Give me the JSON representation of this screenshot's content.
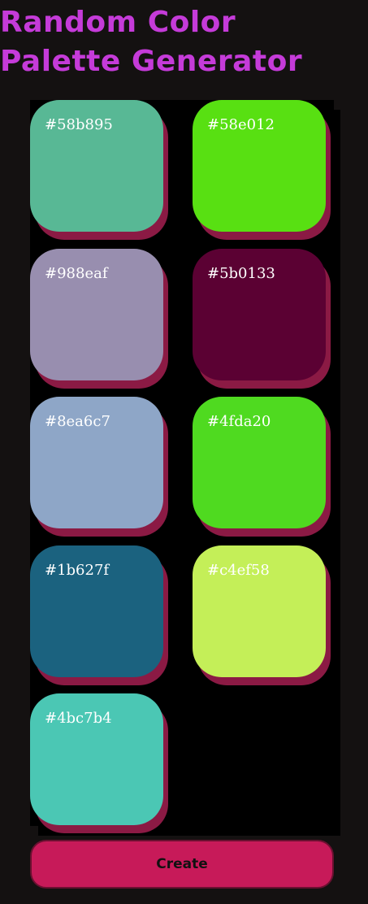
{
  "title": {
    "line1": "Random Color",
    "line2": "Palette Generator"
  },
  "palette": {
    "swatches": [
      {
        "hex": "#58b895",
        "color": "#58b895"
      },
      {
        "hex": "#58e012",
        "color": "#58e012"
      },
      {
        "hex": "#988eaf",
        "color": "#988eaf"
      },
      {
        "hex": "#5b0133",
        "color": "#5b0133"
      },
      {
        "hex": "#8ea6c7",
        "color": "#8ea6c7"
      },
      {
        "hex": "#4fda20",
        "color": "#4fda20"
      },
      {
        "hex": "#1b627f",
        "color": "#1b627f"
      },
      {
        "hex": "#c4ef58",
        "color": "#c4ef58"
      },
      {
        "hex": "#4bc7b4",
        "color": "#4bc7b4"
      }
    ]
  },
  "actions": {
    "create_label": "Create"
  }
}
